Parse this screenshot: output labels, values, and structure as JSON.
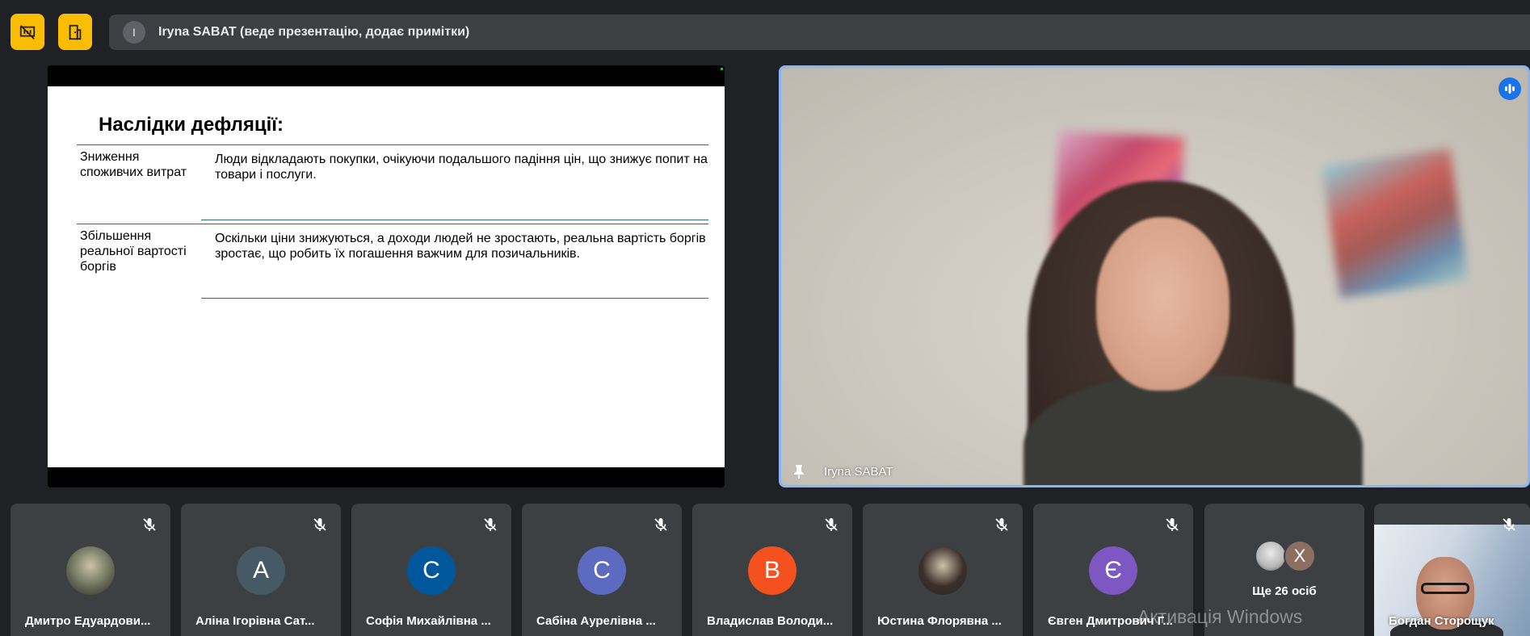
{
  "top_bar": {
    "btn_left_icon": "presentation-off-icon",
    "btn_right_icon": "door-exit-icon",
    "presenter_initial": "I",
    "presenter_text": "Iryna SABAT (веде презентацію, додає примітки)"
  },
  "slide": {
    "title": "Наслідки дефляції:",
    "rows": [
      {
        "term": "Зниження споживчих витрат",
        "desc": "Люди відкладають покупки, очікуючи подальшого падіння цін, що знижує попит на товари і послуги."
      },
      {
        "term": "Збільшення реальної вартості боргів",
        "desc": "Оскільки ціни знижуються, а доходи людей не зростають, реальна вартість боргів зростає, що робить їх погашення важчим для позичальників."
      }
    ]
  },
  "speaker": {
    "name": "Iryna SABAT",
    "pin_icon": "pin-icon",
    "speaking_icon": "audio-level-icon",
    "accent": "#8ab4f8"
  },
  "participants": [
    {
      "name": "Дмитро Едуардови...",
      "initial": "",
      "color": "#6b6f5a",
      "avatar_type": "image",
      "muted": true
    },
    {
      "name": "Аліна Ігорівна Сат...",
      "initial": "А",
      "color": "#455a64",
      "avatar_type": "letter",
      "muted": true
    },
    {
      "name": "Софія Михайлівна ...",
      "initial": "С",
      "color": "#01579b",
      "avatar_type": "letter",
      "muted": true
    },
    {
      "name": "Сабіна Аурелівна ...",
      "initial": "С",
      "color": "#5c6bc0",
      "avatar_type": "letter",
      "muted": true
    },
    {
      "name": "Владислав Володи...",
      "initial": "В",
      "color": "#f4511e",
      "avatar_type": "letter",
      "muted": true
    },
    {
      "name": "Юстина Флорявна ...",
      "initial": "",
      "color": "#3b2e2a",
      "avatar_type": "image",
      "muted": true
    },
    {
      "name": "Євген Дмитрович Г...",
      "initial": "Є",
      "color": "#7e57c2",
      "avatar_type": "letter",
      "muted": true
    }
  ],
  "more": {
    "label": "Ще 26 осіб",
    "avatar_initial": "Х",
    "avatar_color": "#8d6e63"
  },
  "last_participant": {
    "name": "Богдан Сторощук",
    "muted": true
  },
  "watermark": "Активація Windows"
}
